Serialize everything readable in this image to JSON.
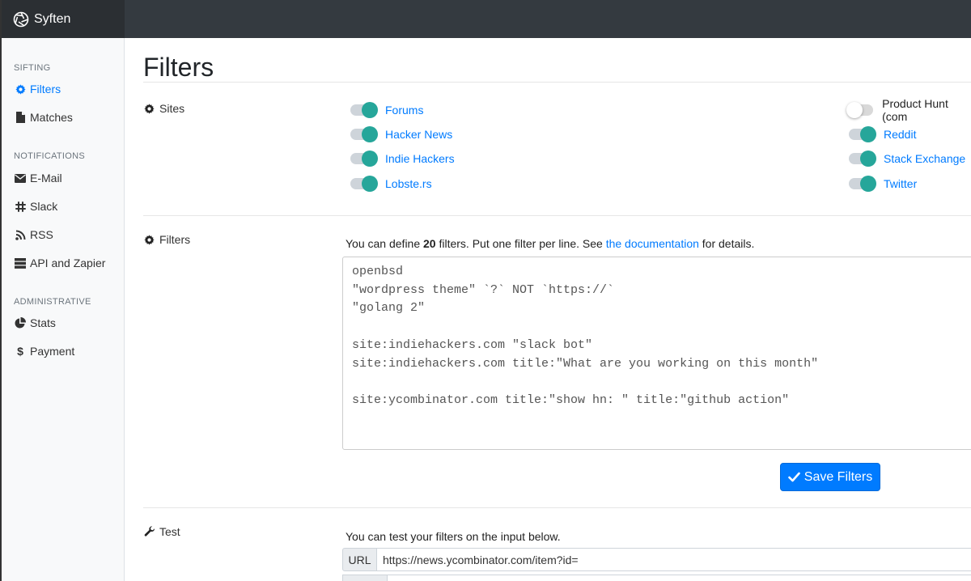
{
  "brand": {
    "name": "Syften"
  },
  "sidebar": {
    "sections": [
      {
        "heading": "SIFTING",
        "items": [
          {
            "label": "Filters",
            "icon": "gear-icon",
            "active": true
          },
          {
            "label": "Matches",
            "icon": "file-icon"
          }
        ]
      },
      {
        "heading": "NOTIFICATIONS",
        "items": [
          {
            "label": "E-Mail",
            "icon": "envelope-icon"
          },
          {
            "label": "Slack",
            "icon": "slack-icon"
          },
          {
            "label": "RSS",
            "icon": "rss-icon"
          },
          {
            "label": "API and Zapier",
            "icon": "server-icon"
          }
        ]
      },
      {
        "heading": "ADMINISTRATIVE",
        "items": [
          {
            "label": "Stats",
            "icon": "pie-chart-icon"
          },
          {
            "label": "Payment",
            "icon": "dollar-icon"
          }
        ]
      }
    ]
  },
  "main": {
    "title": "Filters",
    "sites": {
      "label": "Sites",
      "left": [
        {
          "name": "Forums",
          "enabled": true
        },
        {
          "name": "Hacker News",
          "enabled": true
        },
        {
          "name": "Indie Hackers",
          "enabled": true
        },
        {
          "name": "Lobste.rs",
          "enabled": true
        }
      ],
      "right": [
        {
          "name": "Product Hunt (com",
          "enabled": false
        },
        {
          "name": "Reddit",
          "enabled": true
        },
        {
          "name": "Stack Exchange",
          "enabled": true
        },
        {
          "name": "Twitter",
          "enabled": true
        }
      ]
    },
    "filters": {
      "label": "Filters",
      "desc_prefix": "You can define ",
      "count": "20",
      "desc_middle": " filters. Put one filter per line. See ",
      "doc_link": "the documentation",
      "desc_suffix": " for details.",
      "value": "openbsd\n\"wordpress theme\" `?` NOT `https://`\n\"golang 2\"\n\nsite:indiehackers.com \"slack bot\"\nsite:indiehackers.com title:\"What are you working on this month\"\n\nsite:ycombinator.com title:\"show hn: \" title:\"github action\"",
      "save_label": "Save Filters"
    },
    "test": {
      "label": "Test",
      "desc": "You can test your filters on the input below.",
      "url_label": "URL",
      "url_value": "https://news.ycombinator.com/item?id="
    }
  },
  "colors": {
    "accent": "#007bff",
    "toggle_on": "#26a69a",
    "topbar": "#343a40"
  }
}
